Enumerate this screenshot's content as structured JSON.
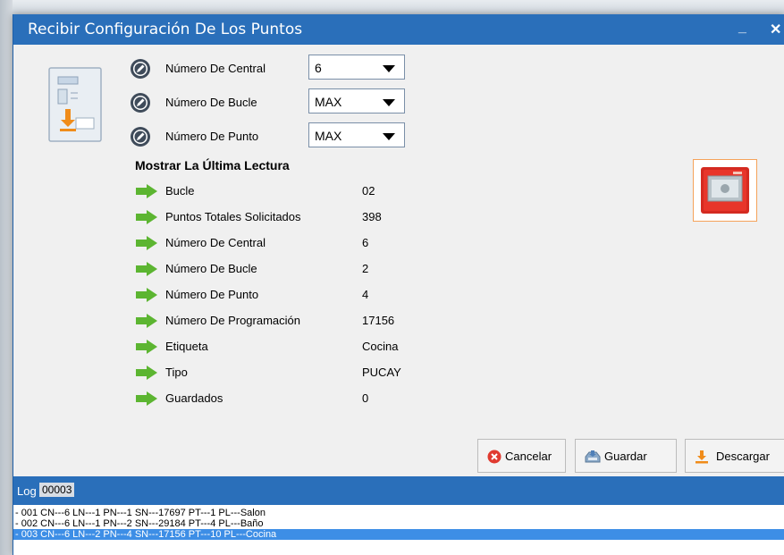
{
  "window": {
    "title": "Recibir Configuración De Los Puntos",
    "minimize_glyph": "_",
    "close_glyph": "✕"
  },
  "fields": [
    {
      "label": "Número De Central",
      "value": "6"
    },
    {
      "label": "Número De Bucle",
      "value": "MAX"
    },
    {
      "label": "Número De Punto",
      "value": "MAX"
    }
  ],
  "last_reading": {
    "title": "Mostrar La Última Lectura",
    "rows": [
      {
        "label": "Bucle",
        "value": "02"
      },
      {
        "label": "Puntos Totales Solicitados",
        "value": "398"
      },
      {
        "label": "Número De Central",
        "value": "6"
      },
      {
        "label": "Número De Bucle",
        "value": "2"
      },
      {
        "label": "Número De Punto",
        "value": "4"
      },
      {
        "label": "Número De Programación",
        "value": "17156"
      },
      {
        "label": "Etiqueta",
        "value": "Cocina"
      },
      {
        "label": "Tipo",
        "value": "PUCAY"
      },
      {
        "label": "Guardados",
        "value": "0"
      }
    ]
  },
  "buttons": {
    "cancel": "Cancelar",
    "save": "Guardar",
    "download": "Descargar"
  },
  "log": {
    "label": "Log",
    "count": "00003",
    "entries": [
      "- 001 CN---6 LN---1 PN---1 SN---17697 PT---1 PL---Salon",
      "- 002 CN---6 LN---1 PN---2 SN---29184 PT---4 PL---Baño",
      "- 003 CN---6 LN---2 PN---4 SN---17156 PT---10 PL---Cocina"
    ],
    "selected_index": 2
  },
  "icons": {
    "edit": "edit-circle-icon",
    "arrow": "green-arrow-icon",
    "device": "fire-panel-download-icon",
    "callpoint": "manual-call-point-icon",
    "cancel": "cancel-x-icon",
    "save": "save-disk-icon",
    "download": "download-arrow-icon"
  },
  "colors": {
    "titlebar": "#2a6fba",
    "arrow_green": "#5cb531",
    "cancel_red": "#e03a2f",
    "download_orange": "#f08c1a",
    "log_selected": "#3d8ee6"
  }
}
